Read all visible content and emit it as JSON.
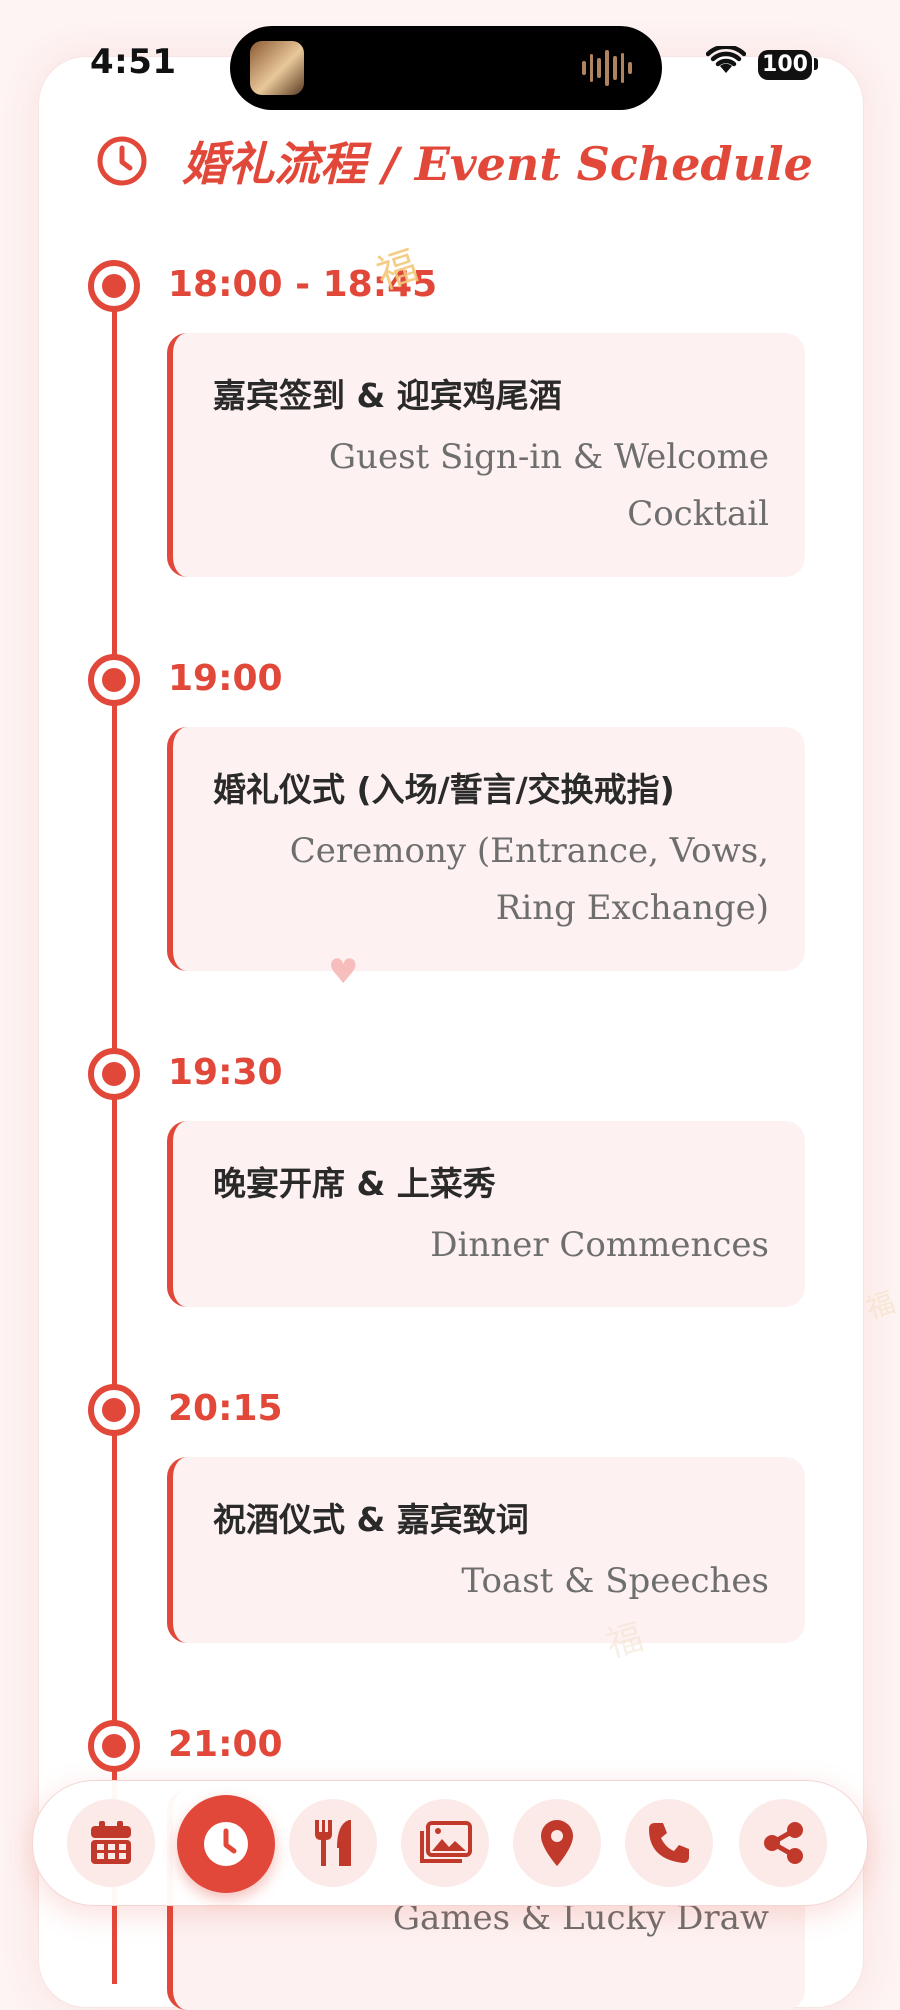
{
  "status_bar": {
    "time": "4:51",
    "battery": "100"
  },
  "header": {
    "title": "婚礼流程 / Event Schedule",
    "icon": "clock-icon"
  },
  "colors": {
    "accent": "#e2483a",
    "card_bg": "#fdf2f1",
    "text_dark": "#2a2a2a",
    "text_muted": "#6e6e6e"
  },
  "schedule": [
    {
      "time": "18:00 - 18:45",
      "title_cn": "嘉宾签到 & 迎宾鸡尾酒",
      "title_en": "Guest Sign-in & Welcome Cocktail"
    },
    {
      "time": "19:00",
      "title_cn": "婚礼仪式 (入场/誓言/交换戒指)",
      "title_en": "Ceremony (Entrance, Vows, Ring Exchange)"
    },
    {
      "time": "19:30",
      "title_cn": "晚宴开席 & 上菜秀",
      "title_en": "Dinner Commences"
    },
    {
      "time": "20:15",
      "title_cn": "祝酒仪式 & 嘉宾致词",
      "title_en": "Toast & Speeches"
    },
    {
      "time": "21:00",
      "title_cn": "",
      "title_en": "Games & Lucky Draw"
    }
  ],
  "decorations": {
    "fu": "福",
    "heart": "♥"
  },
  "bottom_nav": [
    {
      "icon": "calendar-icon",
      "active": false
    },
    {
      "icon": "clock-icon",
      "active": true
    },
    {
      "icon": "utensils-icon",
      "active": false
    },
    {
      "icon": "photos-icon",
      "active": false
    },
    {
      "icon": "location-pin-icon",
      "active": false
    },
    {
      "icon": "phone-icon",
      "active": false
    },
    {
      "icon": "share-icon",
      "active": false
    }
  ]
}
